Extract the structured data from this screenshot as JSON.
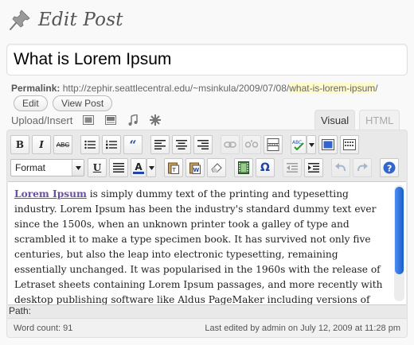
{
  "header": {
    "title": "Edit Post",
    "icon": "pushpin-icon"
  },
  "post": {
    "title": "What is Lorem Ipsum"
  },
  "permalink": {
    "label": "Permalink:",
    "base": "http://zephir.seattlecentral.edu/~msinkula/2009/07/08/",
    "slug": "what-is-lorem-ipsum",
    "trail": "/",
    "edit_label": "Edit",
    "view_label": "View Post"
  },
  "upload": {
    "label": "Upload/Insert"
  },
  "tabs": {
    "visual": "Visual",
    "html": "HTML"
  },
  "toolbar": {
    "format_value": "Format",
    "bold": "B",
    "italic": "I",
    "strike": "ABC",
    "underline": "U",
    "text_color": "A",
    "omega": "Ω"
  },
  "content": {
    "link_text": "Lorem Ipsum",
    "body": " is simply dummy text of the printing and typesetting industry. Lorem Ipsum has been the industry's standard dummy text ever since the 1500s, when an unknown printer took a galley of type and scrambled it to make a type specimen book. It has survived not only five centuries, but also the leap into electronic typesetting, remaining essentially unchanged. It was popularised in the 1960s with the release of Letraset sheets containing Lorem Ipsum passages, and more recently with desktop publishing software like Aldus PageMaker including versions of Lorem Ipsum."
  },
  "path": {
    "label": "Path:"
  },
  "status": {
    "word_count": "Word count: 91",
    "last_edited": "Last edited by admin on July 12, 2009 at 11:28 pm"
  },
  "colors": {
    "accent": "#6b4fa0",
    "scroll": "#2a6fd8",
    "slug_bg": "#fffbcc"
  }
}
